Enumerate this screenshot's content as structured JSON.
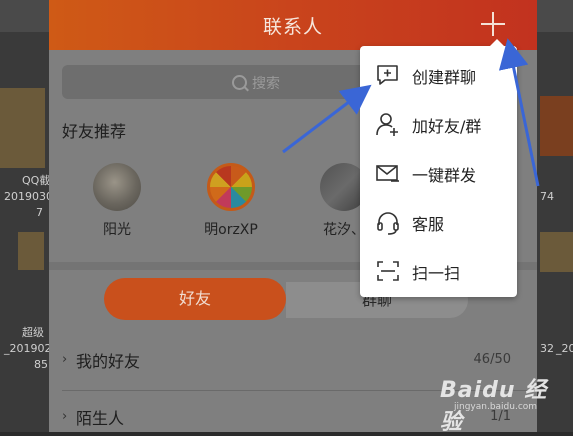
{
  "header": {
    "title": "联系人"
  },
  "search": {
    "placeholder": "搜索"
  },
  "recommend": {
    "title": "好友推荐",
    "friends": [
      {
        "name": "阳光"
      },
      {
        "name": "明orzXP"
      },
      {
        "name": "花汐、"
      }
    ]
  },
  "tabs": {
    "friends": "好友",
    "groups": "群聊"
  },
  "groups": [
    {
      "label": "我的好友",
      "count": "46/50"
    },
    {
      "label": "陌生人",
      "count": "1/1"
    }
  ],
  "menu": {
    "items": [
      {
        "label": "创建群聊",
        "icon": "create-group-icon"
      },
      {
        "label": "加好友/群",
        "icon": "add-friend-icon"
      },
      {
        "label": "一键群发",
        "icon": "mass-message-icon"
      },
      {
        "label": "客服",
        "icon": "customer-service-icon"
      },
      {
        "label": "扫一扫",
        "icon": "scan-icon"
      }
    ]
  },
  "desktop": {
    "labels": [
      "QQ截",
      "2019030",
      "7",
      "超级",
      "_201902",
      "85",
      "74",
      "32",
      "_20"
    ]
  },
  "watermark": {
    "logo": "Baidu 经验",
    "url": "jingyan.baidu.com"
  },
  "colors": {
    "header_start": "#cf5a16",
    "header_end": "#c2321f",
    "accent": "#c9501c",
    "arrow": "#3a66d6"
  }
}
